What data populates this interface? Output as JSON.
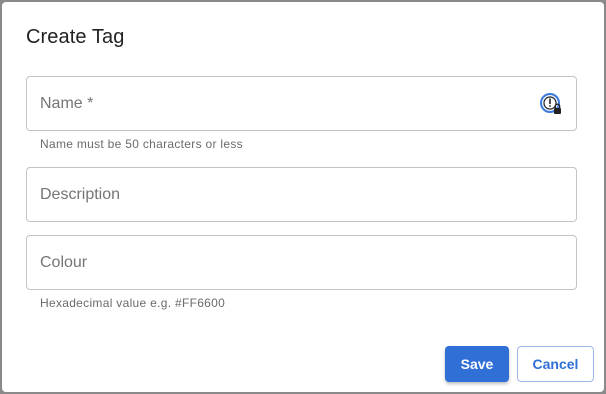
{
  "dialog": {
    "title": "Create Tag",
    "fields": {
      "name": {
        "placeholder": "Name *",
        "helper": "Name must be 50 characters or less",
        "icon": "password-manager-icon"
      },
      "description": {
        "placeholder": "Description"
      },
      "colour": {
        "placeholder": "Colour",
        "helper": "Hexadecimal value e.g. #FF6600"
      }
    },
    "buttons": {
      "save": "Save",
      "cancel": "Cancel"
    }
  },
  "colors": {
    "accent": "#2f6fd6",
    "border": "#c4c4c4",
    "overlay": "#8a8a8a"
  }
}
